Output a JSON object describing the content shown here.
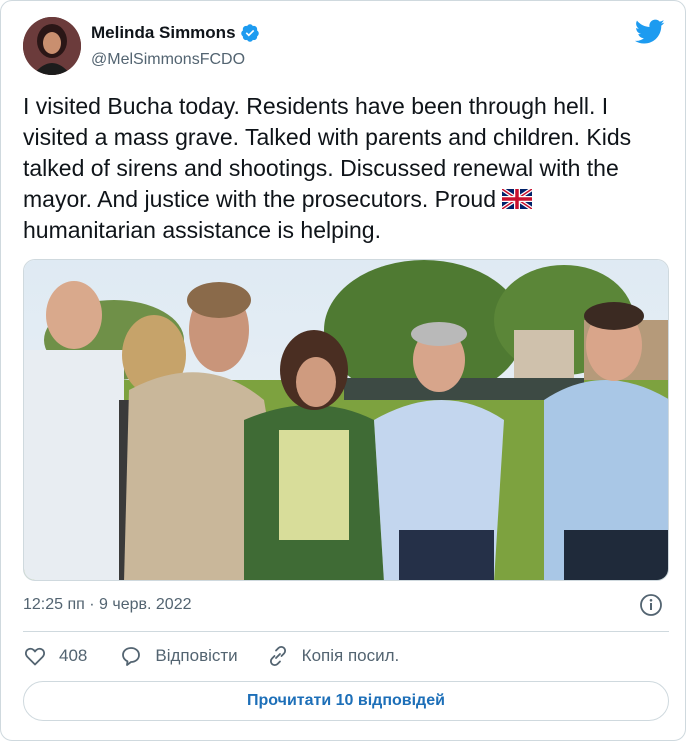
{
  "author": {
    "name": "Melinda Simmons",
    "handle": "@MelSimmonsFCDO"
  },
  "tweet": {
    "text": "I visited Bucha today. Residents have been through hell. I visited a mass grave. Talked with parents and children. Kids talked of sirens and shootings. Discussed renewal with the mayor. And justice with the prosecutors. Proud",
    "text_after_flag": "humanitarian assistance is helping.",
    "flag_icon": "uk-flag-emoji",
    "timestamp": "12:25 пп · 9 черв. 2022"
  },
  "actions": {
    "likes": "408",
    "reply_label": "Відповісти",
    "copy_link_label": "Копія посил."
  },
  "read_replies_label": "Прочитати 10 відповідей",
  "colors": {
    "accent": "#1d9bf0",
    "text": "#0f1419",
    "muted": "#536471",
    "border": "#cfd9de"
  }
}
